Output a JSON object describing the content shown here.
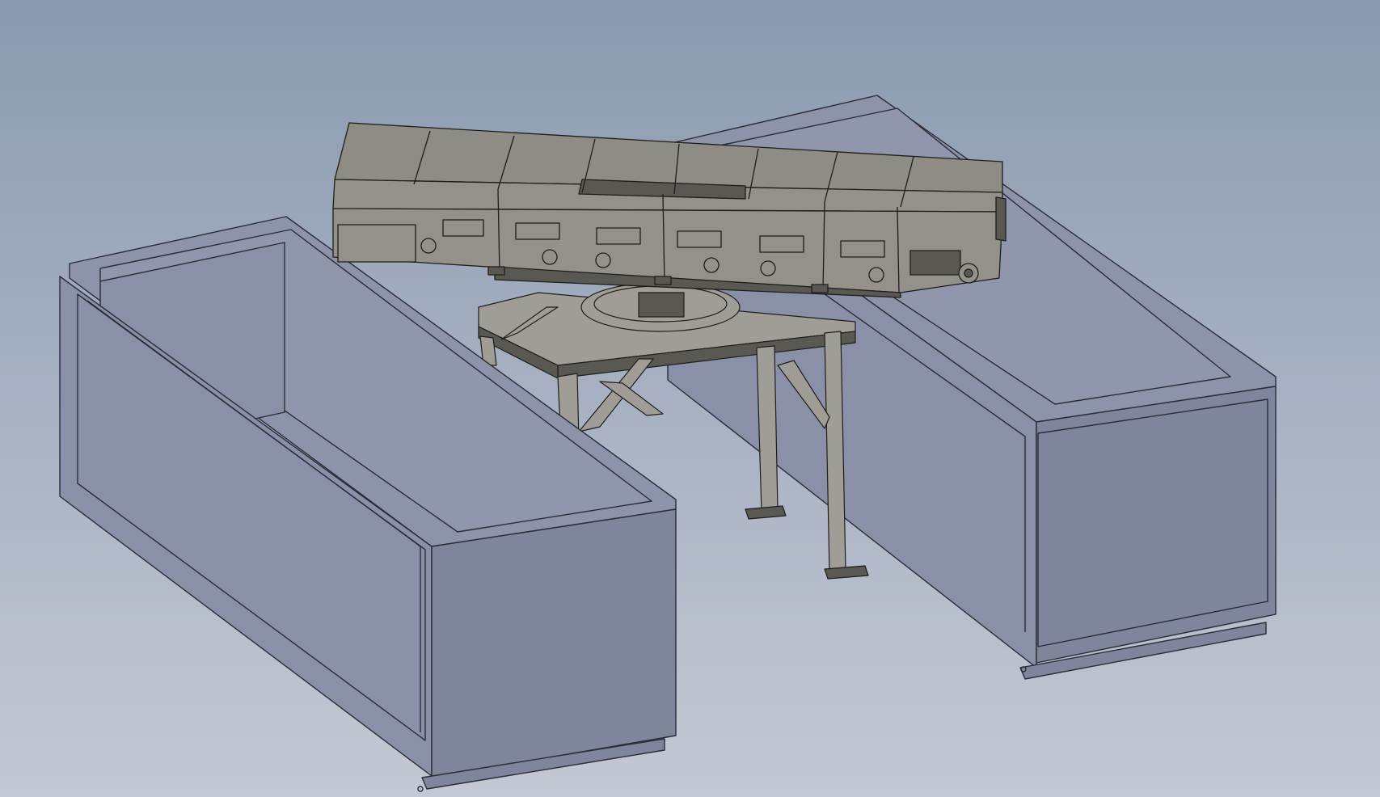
{
  "viewport": {
    "background_top": "#8a9ab0",
    "background_bottom": "#c4c8d4"
  },
  "colors": {
    "bin_face_light": "#8d94aa",
    "bin_face_mid": "#8a90a7",
    "bin_face_dark": "#7f859b",
    "bin_inner": "#9096ab",
    "bin_outline": "#2a2c36",
    "conveyor_top": "#8f8c86",
    "conveyor_side": "#94918a",
    "conveyor_dark": "#5a5852",
    "conveyor_outline": "#1e1d1b",
    "stand_fill": "#a09d96"
  },
  "model": {
    "left_bin": "storage-bin-left",
    "right_bin": "storage-bin-right",
    "conveyor": "belt-conveyor",
    "stand": "support-stand",
    "turntable": "slewing-turntable"
  }
}
